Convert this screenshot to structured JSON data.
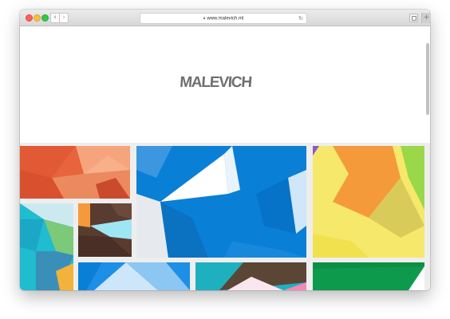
{
  "browser": {
    "url": "www.malevich.ml",
    "lock_icon": "lock-icon",
    "back_icon": "chevron-left-icon",
    "forward_icon": "chevron-right-icon",
    "reload_icon": "reload-icon",
    "tabs_icon": "tabs-overview-icon",
    "new_tab_icon": "plus-icon"
  },
  "site": {
    "logo_text": "MALEVICH",
    "logo_color": "#6f6f6f"
  },
  "gallery": {
    "tiles": [
      {
        "name": "orange-red polygons",
        "colors": [
          "#e8643c",
          "#f4a07a"
        ]
      },
      {
        "name": "blue white polygons",
        "colors": [
          "#0a7fd6",
          "#ffffff"
        ]
      },
      {
        "name": "yellow orange polygons",
        "colors": [
          "#f7e86a",
          "#f59a3a"
        ]
      },
      {
        "name": "teal polygons",
        "colors": [
          "#20bcd0",
          "#7cc97a"
        ]
      },
      {
        "name": "brown orange polygons",
        "colors": [
          "#5a3b30",
          "#f59a3a"
        ]
      },
      {
        "name": "light blue polygons",
        "colors": [
          "#1e8fe6",
          "#cde6fa"
        ]
      },
      {
        "name": "teal brown polygons",
        "colors": [
          "#1fb0c0",
          "#5b4636"
        ]
      },
      {
        "name": "green white polygons",
        "colors": [
          "#0e9a4c",
          "#ffffff"
        ]
      }
    ]
  }
}
